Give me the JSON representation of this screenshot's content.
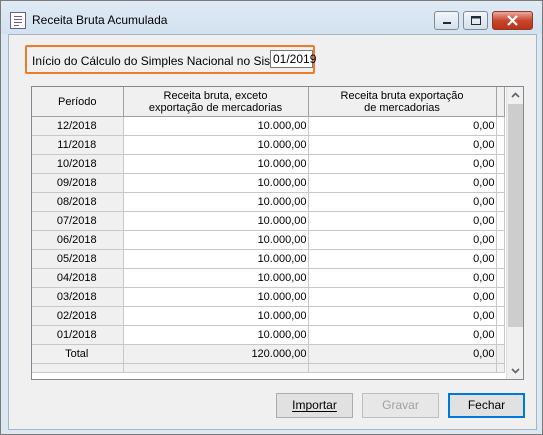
{
  "window": {
    "title": "Receita Bruta Acumulada",
    "icon": "document-list-icon",
    "controls": [
      "minimize-icon",
      "maximize-icon",
      "close-icon"
    ]
  },
  "start": {
    "label": "Início do Cálculo do Simples Nacional no Sistema:",
    "value": "01/2019"
  },
  "table": {
    "headers": [
      "Período",
      "Receita bruta, exceto exportação de mercadorias",
      "Receita bruta exportação de mercadorias"
    ],
    "rows": [
      {
        "period": "12/2018",
        "domestic": "10.000,00",
        "export": "0,00"
      },
      {
        "period": "11/2018",
        "domestic": "10.000,00",
        "export": "0,00"
      },
      {
        "period": "10/2018",
        "domestic": "10.000,00",
        "export": "0,00"
      },
      {
        "period": "09/2018",
        "domestic": "10.000,00",
        "export": "0,00"
      },
      {
        "period": "08/2018",
        "domestic": "10.000,00",
        "export": "0,00"
      },
      {
        "period": "07/2018",
        "domestic": "10.000,00",
        "export": "0,00"
      },
      {
        "period": "06/2018",
        "domestic": "10.000,00",
        "export": "0,00"
      },
      {
        "period": "05/2018",
        "domestic": "10.000,00",
        "export": "0,00"
      },
      {
        "period": "04/2018",
        "domestic": "10.000,00",
        "export": "0,00"
      },
      {
        "period": "03/2018",
        "domestic": "10.000,00",
        "export": "0,00"
      },
      {
        "period": "02/2018",
        "domestic": "10.000,00",
        "export": "0,00"
      },
      {
        "period": "01/2018",
        "domestic": "10.000,00",
        "export": "0,00"
      }
    ],
    "total": {
      "period": "Total",
      "domestic": "120.000,00",
      "export": "0,00"
    }
  },
  "buttons": {
    "import_label": "Importar",
    "save_label": "Gravar",
    "close_label": "Fechar"
  },
  "colors": {
    "highlight_border": "#f07c2a",
    "default_button_border": "#0078d7"
  }
}
